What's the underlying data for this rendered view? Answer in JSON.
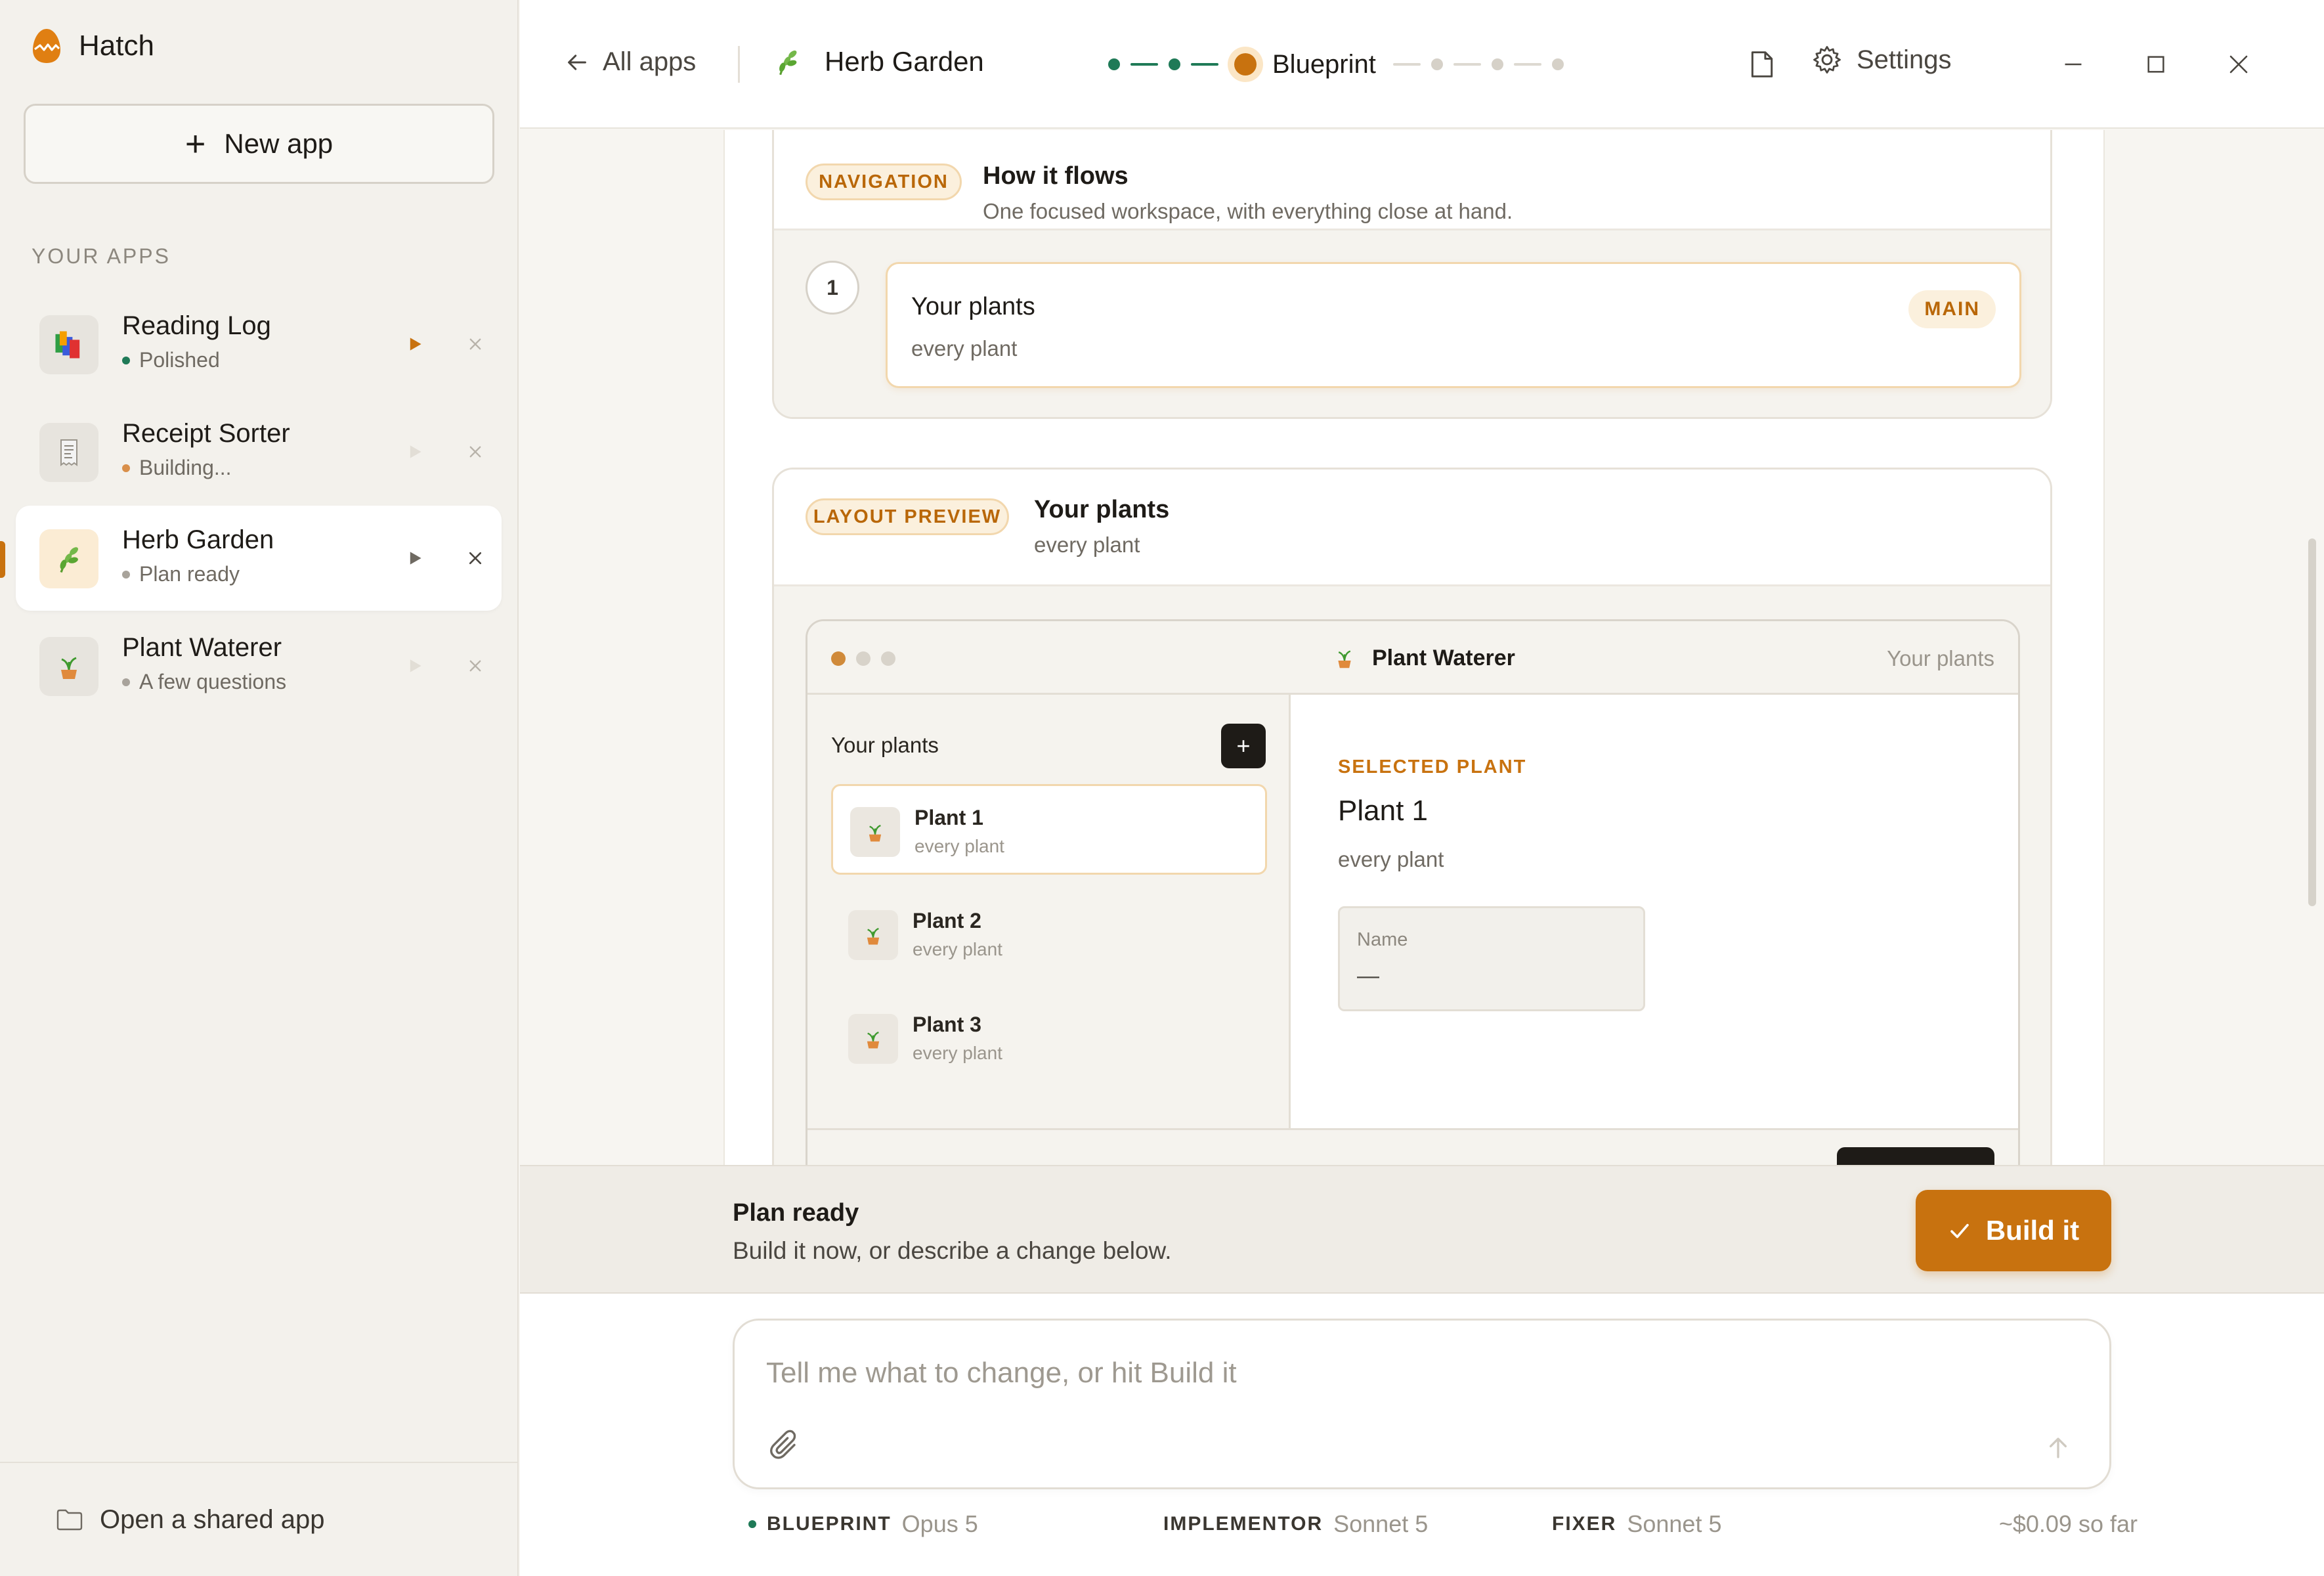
{
  "sidebar": {
    "brand": "Hatch",
    "new_app_label": "New app",
    "section_label": "YOUR APPS",
    "apps": [
      {
        "name": "Reading Log",
        "status": "Polished",
        "status_color": "#1f7a57"
      },
      {
        "name": "Receipt Sorter",
        "status": "Building...",
        "status_color": "#d98f4a"
      },
      {
        "name": "Herb Garden",
        "status": "Plan ready",
        "status_color": "#a8a39b"
      },
      {
        "name": "Plant Waterer",
        "status": "A few questions",
        "status_color": "#a8a39b"
      }
    ],
    "footer_label": "Open a shared app"
  },
  "topbar": {
    "back_label": "All apps",
    "project_name": "Herb Garden",
    "current_step": "Blueprint",
    "settings_label": "Settings"
  },
  "navigation_card": {
    "tag": "NAVIGATION",
    "title": "How it flows",
    "subtitle": "One focused workspace, with everything close at hand.",
    "step_number": "1",
    "screen_title": "Your plants",
    "screen_sub": "every plant",
    "screen_tag": "MAIN"
  },
  "layout_card": {
    "tag": "LAYOUT PREVIEW",
    "title": "Your plants",
    "subtitle": "every plant",
    "mock": {
      "app_name": "Plant Waterer",
      "crumb": "Your plants",
      "list_title": "Your plants",
      "add_label": "+",
      "items": [
        {
          "name": "Plant 1",
          "sub": "every plant"
        },
        {
          "name": "Plant 2",
          "sub": "every plant"
        },
        {
          "name": "Plant 3",
          "sub": "every plant"
        }
      ],
      "selected_label": "SELECTED PLANT",
      "selected_name": "Plant 1",
      "selected_sub": "every plant",
      "field_label": "Name",
      "field_value": "—"
    }
  },
  "plan_bar": {
    "title": "Plan ready",
    "subtitle": "Build it now, or describe a change below.",
    "build_label": "Build it"
  },
  "composer": {
    "placeholder": "Tell me what to change, or hit Build it"
  },
  "models": [
    {
      "role": "BLUEPRINT",
      "model": "Opus 5"
    },
    {
      "role": "IMPLEMENTOR",
      "model": "Sonnet 5"
    },
    {
      "role": "FIXER",
      "model": "Sonnet 5"
    }
  ],
  "cost": "~$0.09 so far",
  "colors": {
    "accent": "#c8720f",
    "done_step": "#1f7a57",
    "pending_step": "#d6d1c8"
  }
}
